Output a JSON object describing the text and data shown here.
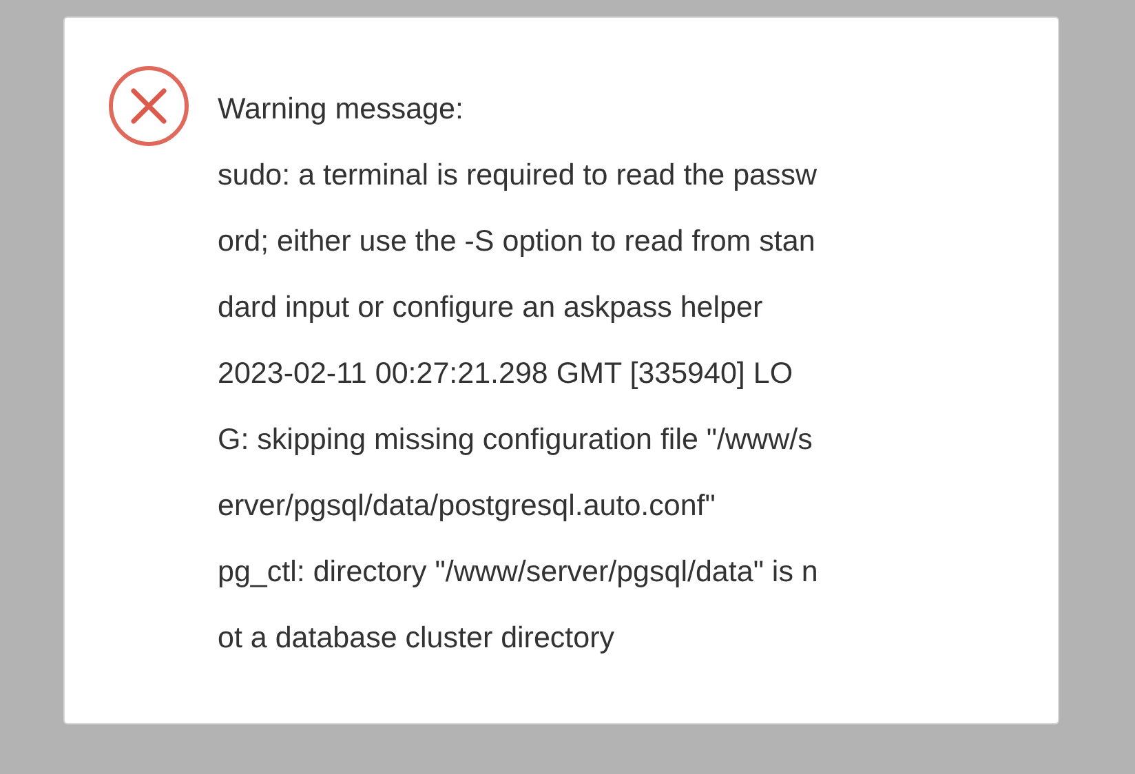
{
  "dialog": {
    "title": "Warning message:",
    "lines": [
      "sudo: a terminal is required to read the passw",
      "ord; either use the -S option to read from stan",
      "dard input or configure an askpass helper",
      "2023-02-11 00:27:21.298 GMT [335940] LO",
      "G: skipping missing configuration file \"/www/s",
      "erver/pgsql/data/postgresql.auto.conf\"",
      "pg_ctl: directory \"/www/server/pgsql/data\" is n",
      "ot a database cluster directory"
    ]
  }
}
